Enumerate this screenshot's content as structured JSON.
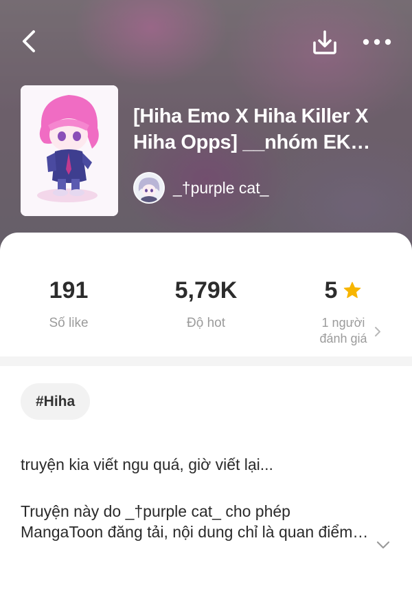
{
  "header": {
    "title": "[Hiha Emo X Hiha Killer X Hiha Opps] __nhóm EK…",
    "author": "_†purple cat_",
    "icons": {
      "back": "back-icon",
      "download": "download-icon",
      "more": "more-icon"
    }
  },
  "stats": {
    "likes": {
      "value": "191",
      "label": "Số like"
    },
    "hot": {
      "value": "5,79K",
      "label": "Độ hot"
    },
    "rating": {
      "value": "5",
      "label_line1": "1 người",
      "label_line2": "đánh giá"
    }
  },
  "tags": [
    "#Hiha"
  ],
  "description": {
    "line1": "truyện kia viết ngu quá, giờ viết lại...",
    "line2": "Truyện này do  _†purple cat_ cho phép",
    "line3": "MangaToon đăng tải, nội dung chỉ là quan điểm của tác giả"
  },
  "colors": {
    "star": "#f7b500",
    "text": "#2c2c2c",
    "muted": "#9b9b9b"
  }
}
